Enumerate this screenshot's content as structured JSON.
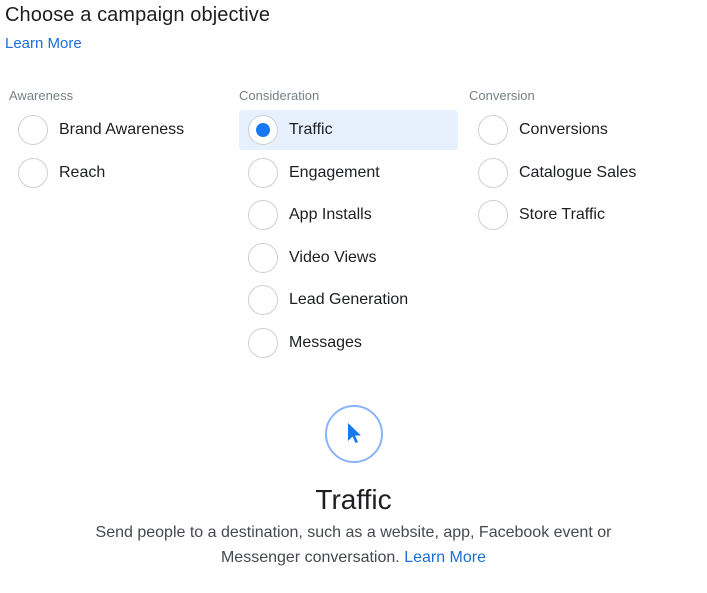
{
  "header": {
    "title": "Choose a campaign objective",
    "learn_more": "Learn More"
  },
  "columns": [
    {
      "heading": "Awareness",
      "options": [
        "Brand Awareness",
        "Reach"
      ]
    },
    {
      "heading": "Consideration",
      "options": [
        "Traffic",
        "Engagement",
        "App Installs",
        "Video Views",
        "Lead Generation",
        "Messages"
      ]
    },
    {
      "heading": "Conversion",
      "options": [
        "Conversions",
        "Catalogue Sales",
        "Store Traffic"
      ]
    }
  ],
  "selected": "Traffic",
  "detail": {
    "icon": "cursor-pointer-icon",
    "title": "Traffic",
    "description": "Send people to a destination, such as a website, app, Facebook event or Messenger conversation.",
    "learn_more": "Learn More"
  },
  "colors": {
    "accent": "#1877f2",
    "link": "#1a6ed8",
    "selected_bg": "#e7f1fe",
    "icon_ring": "#8ab4f8"
  }
}
